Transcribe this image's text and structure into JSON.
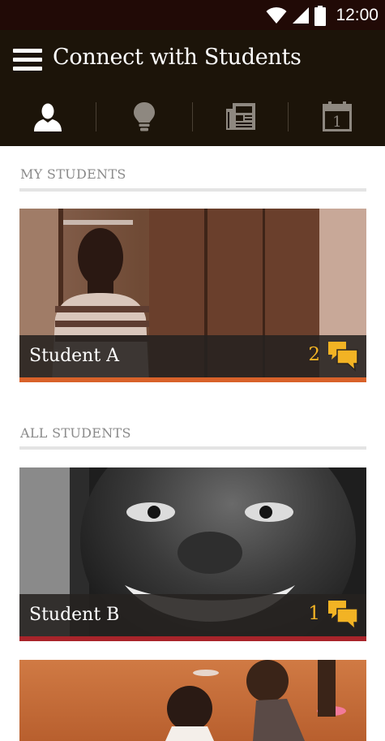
{
  "status_bar": {
    "time": "12:00"
  },
  "app_bar": {
    "title": "Connect with Students",
    "tabs": [
      {
        "icon": "person-icon",
        "active": true
      },
      {
        "icon": "lightbulb-icon",
        "active": false
      },
      {
        "icon": "newspaper-icon",
        "active": false
      },
      {
        "icon": "calendar-icon",
        "active": false,
        "day": "1"
      }
    ]
  },
  "sections": {
    "my_students": {
      "header": "MY STUDENTS",
      "cards": [
        {
          "name": "Student A",
          "message_count": "2",
          "accent": "#d8622a"
        }
      ]
    },
    "all_students": {
      "header": "ALL STUDENTS",
      "cards": [
        {
          "name": "Student B",
          "message_count": "1",
          "accent": "#a8242a"
        }
      ]
    }
  },
  "colors": {
    "status_bar": "#210a06",
    "app_bar": "#1c1409",
    "count": "#f2b324",
    "icon_inactive": "#8e8880"
  }
}
